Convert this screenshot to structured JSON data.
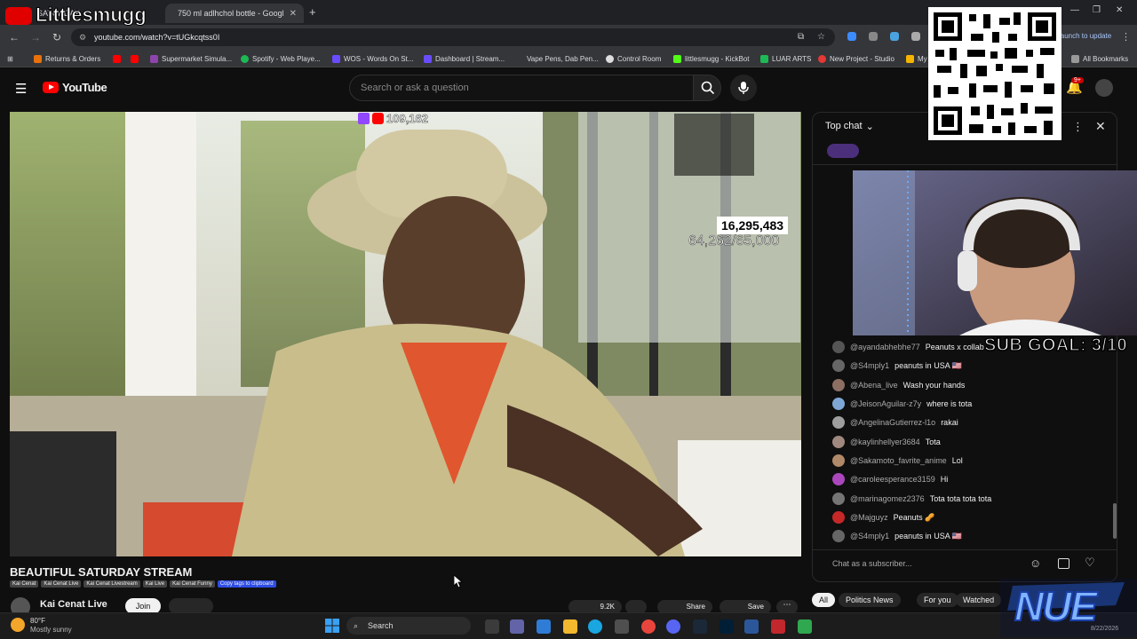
{
  "browser": {
    "tabs": [
      {
        "label": "SATURDAY",
        "active": false
      },
      {
        "label": "750 ml adlhchol bottle - Googl",
        "active": true
      }
    ],
    "new_tab": "+",
    "url": "youtube.com/watch?v=tUGkcqtss0I",
    "relaunch": "launch to update",
    "bookmarks": [
      {
        "label": "Returns & Orders",
        "color": "#e8710a"
      },
      {
        "label": "Supermarket Simula...",
        "color": "#8e44ad"
      },
      {
        "label": "Spotify - Web Playe...",
        "color": "#1db954"
      },
      {
        "label": "WOS - Words On St...",
        "color": "#6a4cff"
      },
      {
        "label": "Dashboard | Stream...",
        "color": "#6a4cff"
      },
      {
        "label": "Vape Pens, Dab Pen...",
        "color": "#999999"
      },
      {
        "label": "Control Room",
        "color": "#dddddd"
      },
      {
        "label": "littlesmugg - KickBot",
        "color": "#53fc18"
      },
      {
        "label": "LUAR ARTS",
        "color": "#1db954"
      },
      {
        "label": "New Project - Studio",
        "color": "#e53935"
      },
      {
        "label": "My",
        "color": "#f4b400"
      }
    ],
    "all_bookmarks": "All Bookmarks"
  },
  "youtube": {
    "logo": "YouTube",
    "search_placeholder": "Search or ask a question",
    "notification_count": "9+"
  },
  "video": {
    "counter_main": "16,295,483",
    "counter_goal": "64,262/65,000",
    "viewer_count": "109,162"
  },
  "chat": {
    "mode": "Top chat",
    "messages": [
      {
        "author": "@ayandabhebhe77",
        "text": "Peanuts x collab",
        "color": "#555555"
      },
      {
        "author": "@S4mply1",
        "text": "peanuts in USA 🇺🇸",
        "color": "#666666"
      },
      {
        "author": "@Abena_live",
        "text": "Wash your hands",
        "color": "#8d6e63"
      },
      {
        "author": "@JeisonAguilar-z7y",
        "text": "where is tota",
        "color": "#7fa7d6"
      },
      {
        "author": "@AngelinaGutierrez-l1o",
        "text": "rakai",
        "color": "#9e9e9e"
      },
      {
        "author": "@kaylinhellyer3684",
        "text": "Tota",
        "color": "#a1887f"
      },
      {
        "author": "@Sakamoto_favrite_anime",
        "text": "Lol",
        "color": "#b08968"
      },
      {
        "author": "@caroleesperance3159",
        "text": "Hi",
        "color": "#ab47bc"
      },
      {
        "author": "@marinagomez2376",
        "text": "Tota tota tota tota",
        "color": "#757575"
      },
      {
        "author": "@Majguyz",
        "text": "Peanuts 🥜",
        "color": "#c62828"
      },
      {
        "author": "@S4mply1",
        "text": "peanuts in USA 🇺🇸",
        "color": "#666666"
      }
    ],
    "input_placeholder": "Chat as a subscriber..."
  },
  "below": {
    "title": "BEAUTIFUL SATURDAY STREAM",
    "tags": [
      "Kai Cenat",
      "Kai Cenat Live",
      "Kai Cenat Livestream",
      "Kai Live",
      "Kai Cenat Funny"
    ],
    "copy_tags": "Copy tags to clipboard",
    "channel": "Kai Cenat Live",
    "join": "Join",
    "likes": "9.2K",
    "share": "Share",
    "save": "Save",
    "filters": [
      "All",
      "Politics News",
      "For you",
      "Watched"
    ]
  },
  "taskbar": {
    "weather_temp": "80°F",
    "weather_desc": "Mostly sunny",
    "search": "Search",
    "date": "8/22/2026"
  },
  "overlay": {
    "streamer_name": "Littlesmugg",
    "sub_goal": "SUB GOAL: 3/10",
    "brand": "NUE"
  }
}
